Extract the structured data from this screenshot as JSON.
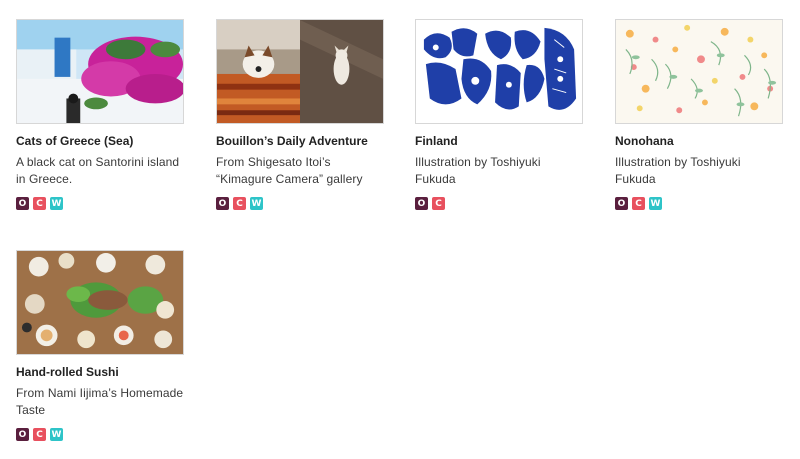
{
  "cards": [
    {
      "title": "Cats of Greece (Sea)",
      "description": "A black cat on Santorini island in Greece.",
      "badges": [
        "O",
        "C",
        "W"
      ]
    },
    {
      "title": "Bouillon’s Daily Adventure",
      "description": "From Shigesato Itoi’s “Kimagure Camera” gallery",
      "badges": [
        "O",
        "C",
        "W"
      ]
    },
    {
      "title": "Finland",
      "description": "Illustration by Toshiyuki Fukuda",
      "badges": [
        "O",
        "C"
      ]
    },
    {
      "title": "Nonohana",
      "description": "Illustration by Toshiyuki Fukuda",
      "badges": [
        "O",
        "C",
        "W"
      ]
    },
    {
      "title": "Hand-rolled Sushi",
      "description": "From Nami Iijima’s Homemade Taste",
      "badges": [
        "O",
        "C",
        "W"
      ]
    }
  ],
  "colors": {
    "badge_o": "#5a1f3e",
    "badge_c": "#e8505e",
    "badge_w": "#2ec4c8"
  }
}
